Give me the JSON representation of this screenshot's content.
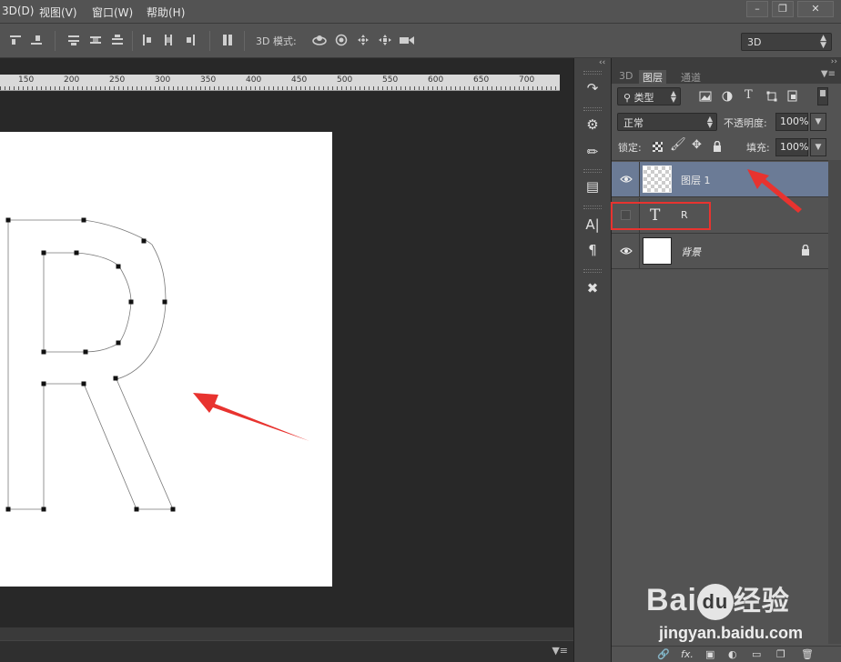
{
  "menu": {
    "items": [
      "3D(D)",
      "视图(V)",
      "窗口(W)",
      "帮助(H)"
    ]
  },
  "window_controls": [
    "minimize",
    "restore",
    "close"
  ],
  "options_bar": {
    "mode3d_label": "3D 模式:",
    "workspace_select": "3D"
  },
  "ruler": {
    "labels": [
      "150",
      "200",
      "250",
      "300",
      "350",
      "400",
      "450",
      "500",
      "550",
      "600",
      "650",
      "700"
    ]
  },
  "canvas": {
    "glyph": "R",
    "anchor_points_visible": true
  },
  "panel": {
    "tabs": [
      "3D",
      "图层",
      "通道"
    ],
    "active_tab": "图层",
    "filter_select": "类型",
    "blend_mode": "正常",
    "opacity_label": "不透明度:",
    "opacity_value": "100%",
    "lock_label": "锁定:",
    "fill_label": "填充:",
    "fill_value": "100%"
  },
  "layers": [
    {
      "name": "图层 1",
      "visible": true,
      "selected": true,
      "kind": "transparent"
    },
    {
      "name": "R",
      "visible": false,
      "selected": false,
      "kind": "type",
      "type_glyph": "T"
    },
    {
      "name": "背景",
      "visible": true,
      "selected": false,
      "kind": "background",
      "locked": true
    }
  ],
  "footer_icons": [
    "link-icon",
    "fx-icon",
    "mask-icon",
    "adjustment-icon",
    "folder-icon",
    "new-layer-icon",
    "trash-icon"
  ],
  "footer_fx_label": "fx.",
  "watermark": {
    "brand": "Bai",
    "brand_du": "du",
    "brand_cn": "经验",
    "url": "jingyan.baidu.com"
  },
  "colors": {
    "selected_layer": "#6b7b96",
    "annotation_red": "#e8332f",
    "panel_bg": "#535353",
    "doc_bg": "#282828"
  }
}
